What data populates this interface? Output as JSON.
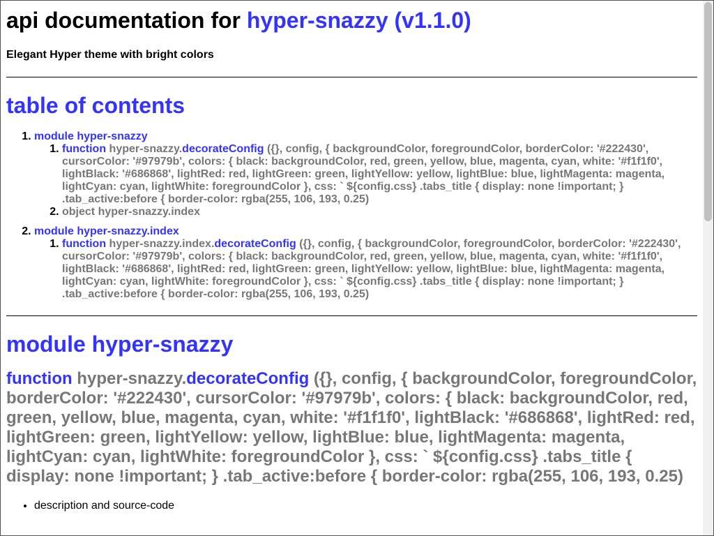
{
  "header": {
    "title_prefix": "api documentation for ",
    "title_link": "hyper-snazzy (v1.1.0)",
    "subtitle": "Elegant Hyper theme with bright colors"
  },
  "toc": {
    "title": "table of contents",
    "modules": [
      {
        "label": "module hyper-snazzy",
        "items": [
          {
            "kind": "function",
            "prefix": " hyper-snazzy.",
            "name": "decorateConfig",
            "signature": " ({}, config, { backgroundColor, foregroundColor, borderColor: '#222430', cursorColor: '#97979b', colors: { black: backgroundColor, red, green, yellow, blue, magenta, cyan, white: '#f1f1f0', lightBlack: '#686868', lightRed: red, lightGreen: green, lightYellow: yellow, lightBlue: blue, lightMagenta: magenta, lightCyan: cyan, lightWhite: foregroundColor }, css: ` ${config.css} .tabs_title { display: none !important; } .tab_active:before { border-color: rgba(255, 106, 193, 0.25)"
          },
          {
            "text": "object hyper-snazzy.index"
          }
        ]
      },
      {
        "label": "module hyper-snazzy.index",
        "items": [
          {
            "kind": "function",
            "prefix": " hyper-snazzy.index.",
            "name": "decorateConfig",
            "signature": " ({}, config, { backgroundColor, foregroundColor, borderColor: '#222430', cursorColor: '#97979b', colors: { black: backgroundColor, red, green, yellow, blue, magenta, cyan, white: '#f1f1f0', lightBlack: '#686868', lightRed: red, lightGreen: green, lightYellow: yellow, lightBlue: blue, lightMagenta: magenta, lightCyan: cyan, lightWhite: foregroundColor }, css: ` ${config.css} .tabs_title { display: none !important; } .tab_active:before { border-color: rgba(255, 106, 193, 0.25)"
          }
        ]
      }
    ]
  },
  "module_section": {
    "title": "module hyper-snazzy",
    "function": {
      "kind": "function",
      "prefix": " hyper-snazzy.",
      "name": "decorateConfig",
      "signature": " ({}, config, { backgroundColor, foregroundColor, borderColor: '#222430', cursorColor: '#97979b', colors: { black: backgroundColor, red, green, yellow, blue, magenta, cyan, white: '#f1f1f0', lightBlack: '#686868', lightRed: red, lightGreen: green, lightYellow: yellow, lightBlue: blue, lightMagenta: magenta, lightCyan: cyan, lightWhite: foregroundColor }, css: ` ${config.css} .tabs_title { display: none !important; } .tab_active:before { border-color: rgba(255, 106, 193, 0.25)"
    },
    "links": [
      "description and source-code"
    ]
  },
  "colors": {
    "link": "#3333ff",
    "muted": "#777777",
    "text": "#000000"
  }
}
